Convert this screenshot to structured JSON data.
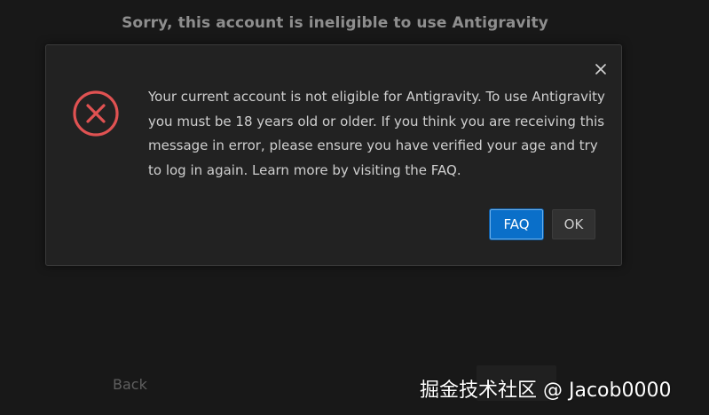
{
  "background": {
    "title": "Sorry, this account is ineligible to use Antigravity",
    "back_label": "Back",
    "watermark": "掘金技术社区 @ Jacob0000"
  },
  "dialog": {
    "close_icon": "close-icon",
    "status_icon": "error-circle-x-icon",
    "message": "Your current account is not eligible for Antigravity. To use Antigravity you must be 18 years old or older. If you think you are receiving this message in error, please ensure you have verified your age and try to log in again. Learn more by visiting the FAQ.",
    "buttons": {
      "faq_label": "FAQ",
      "ok_label": "OK"
    }
  },
  "colors": {
    "background": "#181818",
    "dialog_background": "#222222",
    "error_red": "#e05252",
    "primary_button": "#0a6fc9"
  }
}
